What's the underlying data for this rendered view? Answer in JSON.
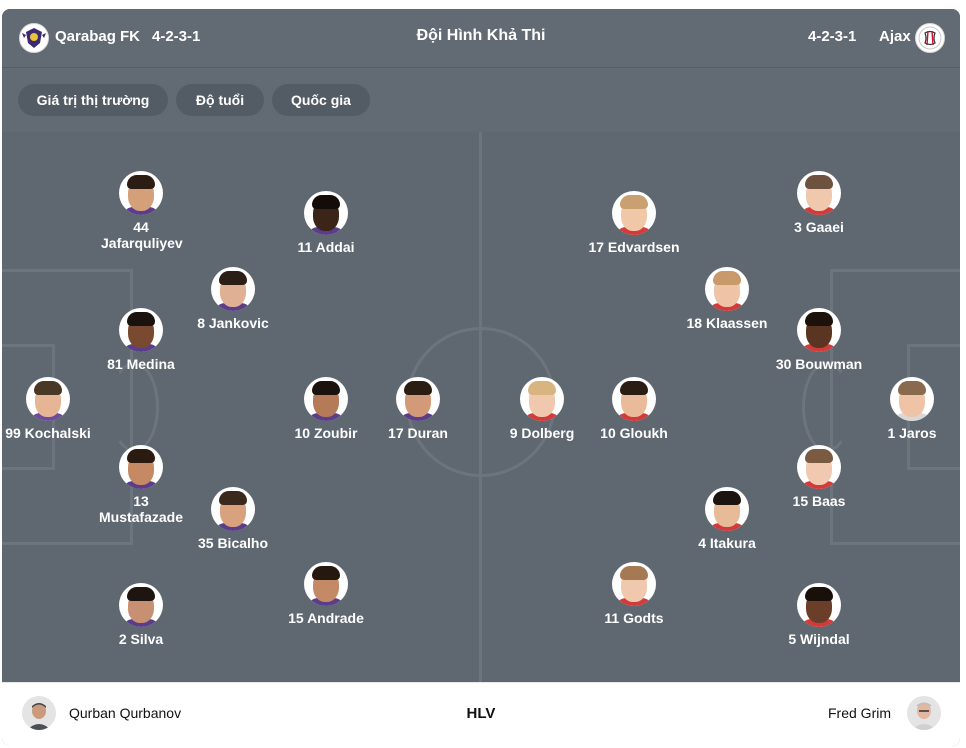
{
  "header": {
    "title": "Đội Hình Khả Thi",
    "home": {
      "name": "Qarabag FK",
      "formation": "4-2-3-1",
      "logo_icon": "qarabag-crest-icon"
    },
    "away": {
      "name": "Ajax",
      "formation": "4-2-3-1",
      "logo_icon": "ajax-crest-icon"
    }
  },
  "tabs": [
    "Giá trị thị trường",
    "Độ tuổi",
    "Quốc gia"
  ],
  "home_players": [
    {
      "label": "99 Kochalski",
      "skin": "#e6b596",
      "hair": "#4a3826",
      "shirt": "#6b4e9b"
    },
    {
      "label": "44 Jafarquliyev",
      "skin": "#d4a07a",
      "hair": "#2b1d14",
      "shirt": "#5a3e8a"
    },
    {
      "label": "81 Medina",
      "skin": "#7a4a30",
      "hair": "#1a120c",
      "shirt": "#5a3e8a"
    },
    {
      "label": "13 Mustafazade",
      "skin": "#c58a63",
      "hair": "#2a1a10",
      "shirt": "#5a3e8a"
    },
    {
      "label": "2 Silva",
      "skin": "#c89072",
      "hair": "#1e1510",
      "shirt": "#5a3e8a"
    },
    {
      "label": "8 Jankovic",
      "skin": "#e0b094",
      "hair": "#2a1e16",
      "shirt": "#5a3e8a"
    },
    {
      "label": "35 Bicalho",
      "skin": "#d8a27e",
      "hair": "#3a2a1e",
      "shirt": "#5a3e8a"
    },
    {
      "label": "11 Addai",
      "skin": "#3b2418",
      "hair": "#140c08",
      "shirt": "#5a3e8a"
    },
    {
      "label": "10 Zoubir",
      "skin": "#b57a58",
      "hair": "#1a120c",
      "shirt": "#5a3e8a"
    },
    {
      "label": "15 Andrade",
      "skin": "#c48a66",
      "hair": "#24180f",
      "shirt": "#5a3e8a"
    },
    {
      "label": "17 Duran",
      "skin": "#d29a78",
      "hair": "#2c1d12",
      "shirt": "#5a3e8a"
    }
  ],
  "away_players": [
    {
      "label": "1 Jaros",
      "skin": "#eec3a6",
      "hair": "#8a6a4e",
      "shirt": "#d8d8d8"
    },
    {
      "label": "3 Gaaei",
      "skin": "#efc8ae",
      "hair": "#6e5240",
      "shirt": "#d33b3b"
    },
    {
      "label": "30 Bouwman",
      "skin": "#5a3622",
      "hair": "#1c120a",
      "shirt": "#d33b3b"
    },
    {
      "label": "15 Baas",
      "skin": "#f0c9b0",
      "hair": "#7a5a40",
      "shirt": "#d33b3b"
    },
    {
      "label": "5 Wijndal",
      "skin": "#6a3e28",
      "hair": "#1a100a",
      "shirt": "#d33b3b"
    },
    {
      "label": "18 Klaassen",
      "skin": "#efc4a6",
      "hair": "#c89a6a",
      "shirt": "#d33b3b"
    },
    {
      "label": "4 Itakura",
      "skin": "#e7bb98",
      "hair": "#1c140e",
      "shirt": "#d33b3b"
    },
    {
      "label": "17 Edvardsen",
      "skin": "#f0c8a8",
      "hair": "#c9a070",
      "shirt": "#d33b3b"
    },
    {
      "label": "10 Gloukh",
      "skin": "#e9bb9a",
      "hair": "#2a1e14",
      "shirt": "#d33b3b"
    },
    {
      "label": "11 Godts",
      "skin": "#f0c8ae",
      "hair": "#a57a52",
      "shirt": "#d33b3b"
    },
    {
      "label": "9 Dolberg",
      "skin": "#f0c8ae",
      "hair": "#d8b480",
      "shirt": "#d33b3b"
    }
  ],
  "footer": {
    "label": "HLV",
    "home_coach": "Qurban Qurbanov",
    "away_coach": "Fred Grim"
  },
  "colors": {
    "pitch": "#5f6770",
    "lines": "#6c747d",
    "header": "#626a73",
    "tab": "#535b64"
  }
}
